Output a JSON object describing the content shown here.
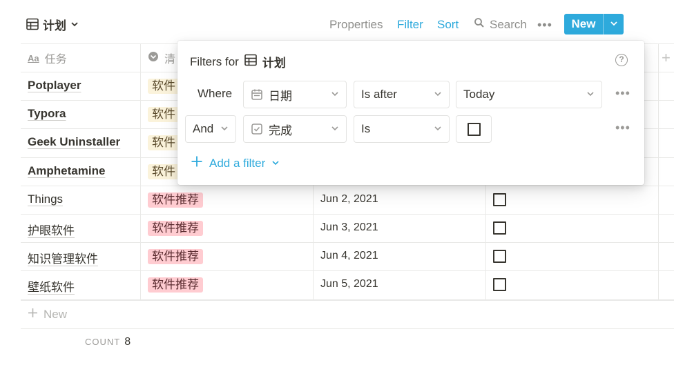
{
  "header": {
    "view_title": "计划",
    "properties": "Properties",
    "filter": "Filter",
    "sort": "Sort",
    "search": "Search",
    "more": "•••",
    "new": "New"
  },
  "columns": {
    "name": "任务",
    "tag": "清",
    "date_icon": "calendar-icon",
    "done_icon": "checkbox-icon"
  },
  "rows": [
    {
      "name": "Potplayer",
      "tag": "软件",
      "tag_color": "yellow",
      "bold": true
    },
    {
      "name": "Typora",
      "tag": "软件",
      "tag_color": "yellow",
      "bold": true
    },
    {
      "name": "Geek Uninstaller",
      "tag": "软件",
      "tag_color": "yellow",
      "bold": true
    },
    {
      "name": "Amphetamine",
      "tag": "软件",
      "tag_color": "yellow",
      "bold": true
    },
    {
      "name": "Things",
      "tag": "软件推荐",
      "tag_color": "red",
      "date": "Jun 2, 2021",
      "done": false
    },
    {
      "name": "护眼软件",
      "tag": "软件推荐",
      "tag_color": "red",
      "date": "Jun 3, 2021",
      "done": false
    },
    {
      "name": "知识管理软件",
      "tag": "软件推荐",
      "tag_color": "red",
      "date": "Jun 4, 2021",
      "done": false
    },
    {
      "name": "壁纸软件",
      "tag": "软件推荐",
      "tag_color": "red",
      "date": "Jun 5, 2021",
      "done": false
    }
  ],
  "footer": {
    "new_row": "New",
    "count_label": "COUNT",
    "count_value": "8"
  },
  "filter_popup": {
    "title_prefix": "Filters for",
    "title_name": "计划",
    "help": "?",
    "row1": {
      "conjunction": "Where",
      "property": "日期",
      "operator": "Is after",
      "value": "Today",
      "more": "•••"
    },
    "row2": {
      "conjunction": "And",
      "property": "完成",
      "operator": "Is",
      "value_checked": false,
      "more": "•••"
    },
    "add_filter": "Add a filter"
  },
  "colors": {
    "accent": "#2eaadc",
    "tag_red": "#ffccd1",
    "tag_yellow": "#fbf3db",
    "text": "#37352f",
    "muted": "#9b9a97"
  }
}
